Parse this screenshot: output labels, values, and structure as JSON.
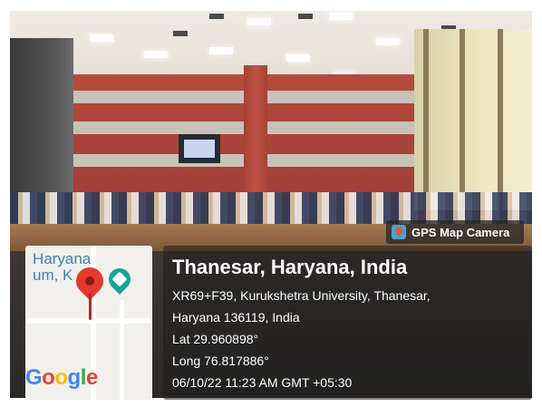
{
  "badge": {
    "label": "GPS Map Camera",
    "icon": "map-pin-icon"
  },
  "map": {
    "city_line1": "Haryana",
    "city_line2": "um, K",
    "logo": [
      "G",
      "o",
      "o",
      "g",
      "l",
      "e"
    ]
  },
  "location": {
    "title": "Thanesar, Haryana, India",
    "address_line1": "XR69+F39, Kurukshetra University, Thanesar,",
    "address_line2": "Haryana 136119, India",
    "lat": "Lat 29.960898°",
    "long": "Long 76.817886°",
    "datetime": "06/10/22 11:23 AM GMT +05:30"
  },
  "colors": {
    "pin": "#e23a2e",
    "poi": "#1aa29b",
    "map_text": "#3d7fc0"
  }
}
